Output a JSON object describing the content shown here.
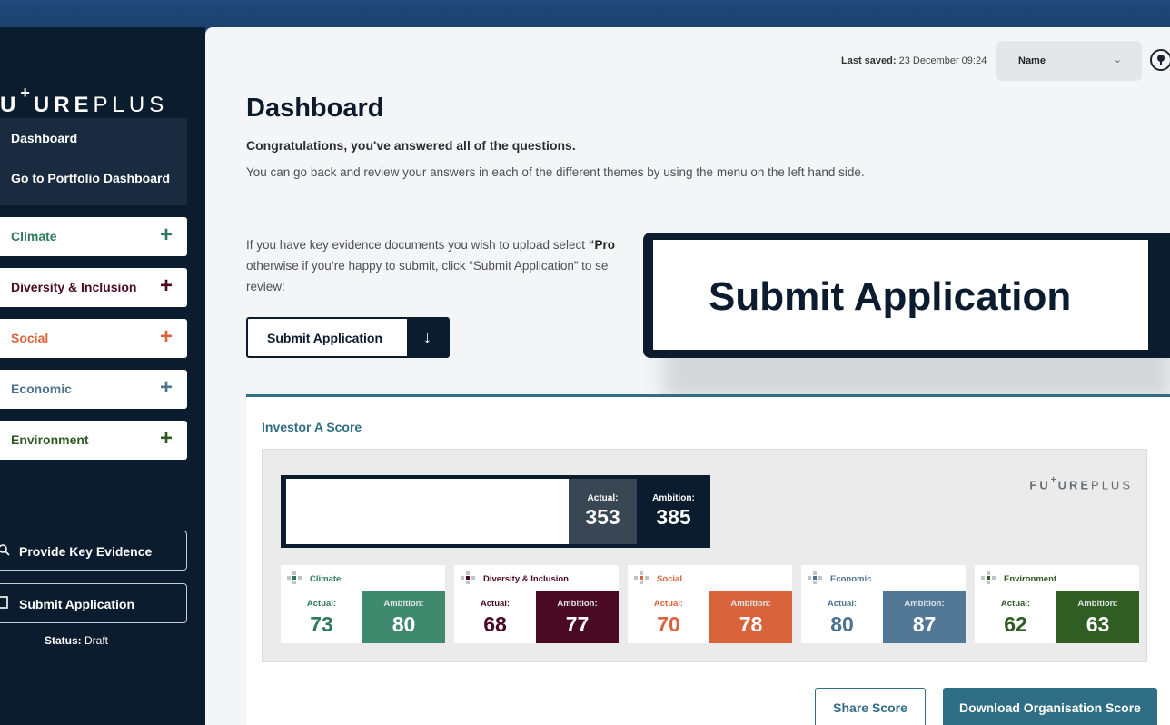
{
  "brand": {
    "logo_prefix": "U",
    "logo_sup": "+",
    "logo_bold": "URE",
    "logo_light": "PLUS"
  },
  "sidebar": {
    "nav": [
      {
        "label": "Dashboard"
      },
      {
        "label": "Go to Portfolio Dashboard"
      }
    ],
    "themes": [
      {
        "label": "Climate",
        "color": "#2f7a5a"
      },
      {
        "label": "Diversity & Inclusion",
        "color": "#4a0a23"
      },
      {
        "label": "Social",
        "color": "#d9643c"
      },
      {
        "label": "Economic",
        "color": "#4e7391"
      },
      {
        "label": "Environment",
        "color": "#2f5a22"
      }
    ],
    "plus_symbol": "+",
    "actions": {
      "evidence_label": "Provide Key Evidence",
      "submit_label": "Submit Application"
    },
    "status_label": "Status:",
    "status_value": "Draft"
  },
  "header": {
    "last_saved_label": "Last saved:",
    "last_saved_value": "23 December 09:24",
    "name_select": "Name"
  },
  "main": {
    "title": "Dashboard",
    "congrats": "Congratulations, you've answered all of the questions.",
    "para1": "You can go back and review your answers in each of the different themes by using the menu on the left hand side.",
    "para2_start": "If you have key evidence documents you wish to upload select ",
    "para2_bold": "“Pro",
    "para2_line2": "otherwise if you’re happy to submit, click “Submit Application” to se",
    "para2_line3": "review:",
    "submit_button": "Submit Application",
    "callout_text": "Submit Application"
  },
  "score": {
    "title": "Investor A Score",
    "actual_label": "Actual:",
    "ambition_label": "Ambition:",
    "total_actual": "353",
    "total_ambition": "385",
    "panel_logo_prefix": "FU",
    "panel_logo_sup": "+",
    "panel_logo_bold": "URE",
    "panel_logo_light": "PLUS",
    "themes": [
      {
        "name": "Climate",
        "actual": "73",
        "ambition": "80",
        "color": "#3f8a6e",
        "text_color": "#2f7a5a"
      },
      {
        "name": "Diversity & Inclusion",
        "actual": "68",
        "ambition": "77",
        "color": "#4a0a23",
        "text_color": "#4a0a23"
      },
      {
        "name": "Social",
        "actual": "70",
        "ambition": "78",
        "color": "#d9643c",
        "text_color": "#d9643c"
      },
      {
        "name": "Economic",
        "actual": "80",
        "ambition": "87",
        "color": "#527896",
        "text_color": "#4e7391"
      },
      {
        "name": "Environment",
        "actual": "62",
        "ambition": "63",
        "color": "#305d23",
        "text_color": "#2f5a22"
      }
    ],
    "share_button": "Share Score",
    "download_button": "Download Organisation Score"
  }
}
